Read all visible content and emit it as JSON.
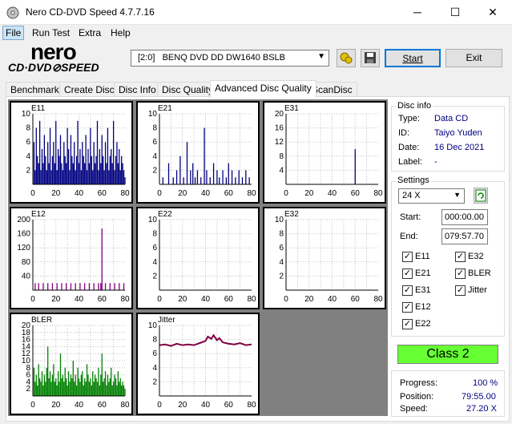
{
  "window": {
    "title": "Nero CD-DVD Speed 4.7.7.16",
    "minimize": "─",
    "maximize": "☐",
    "close": "✕"
  },
  "menu": {
    "file": "File",
    "run_test": "Run Test",
    "extra": "Extra",
    "help": "Help"
  },
  "logo": {
    "line1": "nero",
    "line2": "CD·DVD⊘SPEED"
  },
  "toolbar": {
    "drive": "[2:0]   BENQ DVD DD DW1640 BSLB",
    "start": "Start",
    "exit": "Exit"
  },
  "tabs": [
    "Benchmark",
    "Create Disc",
    "Disc Info",
    "Disc Quality",
    "Advanced Disc Quality",
    "ScanDisc"
  ],
  "active_tab": "Advanced Disc Quality",
  "disc_info": {
    "group_label": "Disc info",
    "type_label": "Type:",
    "type_value": "Data CD",
    "id_label": "ID:",
    "id_value": "Taiyo Yuden",
    "date_label": "Date:",
    "date_value": "16 Dec 2021",
    "label_label": "Label:",
    "label_value": "-"
  },
  "settings": {
    "group_label": "Settings",
    "speed": "24 X",
    "start_label": "Start:",
    "start_value": "000:00.00",
    "end_label": "End:",
    "end_value": "079:57.70",
    "checks": [
      {
        "label": "E11",
        "checked": true
      },
      {
        "label": "E32",
        "checked": true
      },
      {
        "label": "E21",
        "checked": true
      },
      {
        "label": "BLER",
        "checked": true
      },
      {
        "label": "E31",
        "checked": true
      },
      {
        "label": "Jitter",
        "checked": true
      },
      {
        "label": "E12",
        "checked": true
      },
      {
        "label": "E22",
        "checked": true
      }
    ]
  },
  "class_result": "Class 2",
  "status": {
    "progress_label": "Progress:",
    "progress_value": "100 %",
    "position_label": "Position:",
    "position_value": "79:55.00",
    "speed_label": "Speed:",
    "speed_value": "27.20 X"
  },
  "chart_data": [
    {
      "type": "bar",
      "title": "E11",
      "xlim": [
        0,
        80
      ],
      "ylim": [
        0,
        10
      ],
      "yticks": [
        2,
        4,
        6,
        8,
        10
      ],
      "xticks": [
        0,
        20,
        40,
        60,
        80
      ],
      "color": "#000080",
      "x": [
        1,
        2,
        3,
        4,
        5,
        6,
        7,
        8,
        9,
        10,
        11,
        12,
        13,
        14,
        15,
        16,
        17,
        18,
        19,
        20,
        21,
        22,
        23,
        24,
        25,
        26,
        27,
        28,
        29,
        30,
        31,
        32,
        33,
        34,
        35,
        36,
        37,
        38,
        39,
        40,
        41,
        42,
        43,
        44,
        45,
        46,
        47,
        48,
        49,
        50,
        51,
        52,
        53,
        54,
        55,
        56,
        57,
        58,
        59,
        60,
        61,
        62,
        63,
        64,
        65,
        66,
        67,
        68,
        69,
        70,
        71,
        72,
        73,
        74,
        75,
        76,
        77,
        78,
        79,
        80
      ],
      "values": [
        6,
        2,
        8,
        4,
        3,
        9,
        2,
        5,
        3,
        7,
        4,
        2,
        6,
        3,
        8,
        2,
        4,
        6,
        3,
        9,
        2,
        5,
        4,
        7,
        3,
        2,
        6,
        4,
        3,
        8,
        5,
        2,
        7,
        4,
        3,
        6,
        2,
        4,
        9,
        3,
        5,
        2,
        6,
        4,
        3,
        7,
        2,
        5,
        3,
        8,
        4,
        2,
        6,
        3,
        4,
        9,
        2,
        5,
        3,
        7,
        4,
        2,
        6,
        3,
        8,
        2,
        4,
        5,
        3,
        9,
        2,
        4,
        6,
        3,
        5,
        2,
        4,
        3,
        2,
        1
      ]
    },
    {
      "type": "bar",
      "title": "E21",
      "xlim": [
        0,
        80
      ],
      "ylim": [
        0,
        10
      ],
      "yticks": [
        2,
        4,
        6,
        8,
        10
      ],
      "xticks": [
        0,
        20,
        40,
        60,
        80
      ],
      "color": "#000080",
      "x": [
        3,
        8,
        12,
        15,
        18,
        21,
        24,
        27,
        29,
        31,
        33,
        36,
        39,
        41,
        44,
        47,
        50,
        52,
        55,
        58,
        60,
        63,
        66,
        69,
        72,
        75,
        78
      ],
      "values": [
        1,
        3,
        1,
        2,
        4,
        1,
        6,
        2,
        3,
        1,
        2,
        1,
        8,
        2,
        1,
        3,
        2,
        1,
        2,
        1,
        3,
        2,
        1,
        2,
        1,
        2,
        1
      ]
    },
    {
      "type": "bar",
      "title": "E31",
      "xlim": [
        0,
        80
      ],
      "ylim": [
        0,
        20
      ],
      "yticks": [
        4,
        8,
        12,
        16,
        20
      ],
      "xticks": [
        0,
        20,
        40,
        60,
        80
      ],
      "color": "#000080",
      "x": [
        60
      ],
      "values": [
        10
      ]
    },
    {
      "type": "bar",
      "title": "E12",
      "xlim": [
        0,
        80
      ],
      "ylim": [
        0,
        200
      ],
      "yticks": [
        40,
        80,
        120,
        160,
        200
      ],
      "xticks": [
        0,
        20,
        40,
        60,
        80
      ],
      "color": "#800080",
      "x": [
        2,
        5,
        9,
        13,
        17,
        21,
        25,
        29,
        33,
        37,
        41,
        45,
        49,
        53,
        57,
        59,
        60,
        63,
        67,
        71,
        75,
        79
      ],
      "values": [
        20,
        20,
        20,
        20,
        20,
        20,
        20,
        20,
        20,
        20,
        20,
        20,
        20,
        20,
        20,
        20,
        175,
        20,
        20,
        20,
        20,
        20
      ]
    },
    {
      "type": "bar",
      "title": "E22",
      "xlim": [
        0,
        80
      ],
      "ylim": [
        0,
        10
      ],
      "yticks": [
        2,
        4,
        6,
        8,
        10
      ],
      "xticks": [
        0,
        20,
        40,
        60,
        80
      ],
      "color": "#000080",
      "x": [],
      "values": []
    },
    {
      "type": "bar",
      "title": "E32",
      "xlim": [
        0,
        80
      ],
      "ylim": [
        0,
        10
      ],
      "yticks": [
        2,
        4,
        6,
        8,
        10
      ],
      "xticks": [
        0,
        20,
        40,
        60,
        80
      ],
      "color": "#000080",
      "x": [],
      "values": []
    },
    {
      "type": "bar",
      "title": "BLER",
      "xlim": [
        0,
        80
      ],
      "ylim": [
        0,
        20
      ],
      "yticks": [
        2,
        4,
        6,
        8,
        10,
        12,
        14,
        16,
        18,
        20
      ],
      "xticks": [
        0,
        20,
        40,
        60,
        80
      ],
      "color": "#008000",
      "x": [
        1,
        2,
        3,
        4,
        5,
        6,
        7,
        8,
        9,
        10,
        11,
        12,
        13,
        14,
        15,
        16,
        17,
        18,
        19,
        20,
        21,
        22,
        23,
        24,
        25,
        26,
        27,
        28,
        29,
        30,
        31,
        32,
        33,
        34,
        35,
        36,
        37,
        38,
        39,
        40,
        41,
        42,
        43,
        44,
        45,
        46,
        47,
        48,
        49,
        50,
        51,
        52,
        53,
        54,
        55,
        56,
        57,
        58,
        59,
        60,
        61,
        62,
        63,
        64,
        65,
        66,
        67,
        68,
        69,
        70,
        71,
        72,
        73,
        74,
        75,
        76,
        77,
        78,
        79,
        80
      ],
      "values": [
        8,
        4,
        6,
        3,
        9,
        5,
        4,
        7,
        3,
        6,
        4,
        8,
        14,
        5,
        7,
        4,
        6,
        9,
        4,
        5,
        3,
        7,
        4,
        12,
        5,
        6,
        4,
        8,
        5,
        3,
        7,
        4,
        6,
        5,
        10,
        4,
        6,
        3,
        8,
        5,
        4,
        6,
        7,
        3,
        5,
        4,
        9,
        6,
        4,
        5,
        3,
        7,
        4,
        6,
        5,
        4,
        8,
        3,
        6,
        12,
        4,
        5,
        7,
        3,
        6,
        4,
        5,
        8,
        3,
        4,
        6,
        5,
        3,
        7,
        4,
        5,
        3,
        4,
        3,
        2
      ]
    },
    {
      "type": "line",
      "title": "Jitter",
      "xlim": [
        0,
        80
      ],
      "ylim": [
        0,
        10
      ],
      "yticks": [
        2,
        4,
        6,
        8,
        10
      ],
      "xticks": [
        0,
        20,
        40,
        60,
        80
      ],
      "color": "#800040",
      "x": [
        0,
        5,
        10,
        15,
        20,
        25,
        30,
        35,
        40,
        42,
        45,
        47,
        50,
        52,
        55,
        60,
        65,
        70,
        75,
        80
      ],
      "values": [
        7.2,
        7.3,
        7.1,
        7.4,
        7.2,
        7.3,
        7.2,
        7.5,
        7.8,
        8.4,
        8.1,
        8.6,
        7.9,
        8.2,
        7.6,
        7.4,
        7.3,
        7.5,
        7.2,
        7.3
      ]
    }
  ]
}
